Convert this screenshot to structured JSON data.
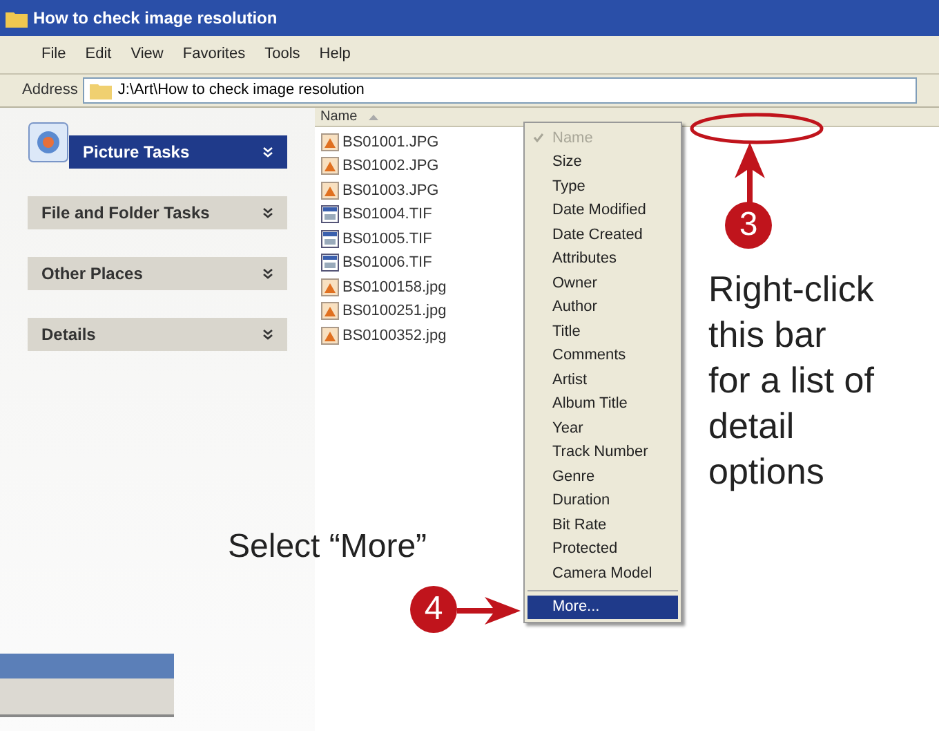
{
  "window": {
    "title": "How to check image resolution"
  },
  "menu_bar": [
    "File",
    "Edit",
    "View",
    "Favorites",
    "Tools",
    "Help"
  ],
  "address_bar": {
    "label": "Address",
    "value": "J:\\Art\\How to check image resolution"
  },
  "task_panes": [
    {
      "title": "Picture Tasks",
      "kind": "special"
    },
    {
      "title": "File and Folder Tasks",
      "kind": "normal"
    },
    {
      "title": "Other Places",
      "kind": "normal"
    },
    {
      "title": "Details",
      "kind": "normal"
    }
  ],
  "column_header": {
    "label": "Name"
  },
  "files": [
    {
      "name": "BS01001.JPG",
      "kind": "photo"
    },
    {
      "name": "BS01002.JPG",
      "kind": "photo"
    },
    {
      "name": "BS01003.JPG",
      "kind": "photo"
    },
    {
      "name": "BS01004.TIF",
      "kind": "tif"
    },
    {
      "name": "BS01005.TIF",
      "kind": "tif"
    },
    {
      "name": "BS01006.TIF",
      "kind": "tif"
    },
    {
      "name": "BS0100158.jpg",
      "kind": "photo"
    },
    {
      "name": "BS0100251.jpg",
      "kind": "photo"
    },
    {
      "name": "BS0100352.jpg",
      "kind": "photo"
    }
  ],
  "context_menu": [
    {
      "label": "Name",
      "checked": true,
      "disabled": true,
      "selected": false
    },
    {
      "label": "Size",
      "checked": false,
      "disabled": false,
      "selected": false
    },
    {
      "label": "Type",
      "checked": false,
      "disabled": false,
      "selected": false
    },
    {
      "label": "Date Modified",
      "checked": false,
      "disabled": false,
      "selected": false
    },
    {
      "label": "Date Created",
      "checked": false,
      "disabled": false,
      "selected": false
    },
    {
      "label": "Attributes",
      "checked": false,
      "disabled": false,
      "selected": false
    },
    {
      "label": "Owner",
      "checked": false,
      "disabled": false,
      "selected": false
    },
    {
      "label": "Author",
      "checked": false,
      "disabled": false,
      "selected": false
    },
    {
      "label": "Title",
      "checked": false,
      "disabled": false,
      "selected": false
    },
    {
      "label": "Comments",
      "checked": false,
      "disabled": false,
      "selected": false
    },
    {
      "label": "Artist",
      "checked": false,
      "disabled": false,
      "selected": false
    },
    {
      "label": "Album Title",
      "checked": false,
      "disabled": false,
      "selected": false
    },
    {
      "label": "Year",
      "checked": false,
      "disabled": false,
      "selected": false
    },
    {
      "label": "Track Number",
      "checked": false,
      "disabled": false,
      "selected": false
    },
    {
      "label": "Genre",
      "checked": false,
      "disabled": false,
      "selected": false
    },
    {
      "label": "Duration",
      "checked": false,
      "disabled": false,
      "selected": false
    },
    {
      "label": "Bit Rate",
      "checked": false,
      "disabled": false,
      "selected": false
    },
    {
      "label": "Protected",
      "checked": false,
      "disabled": false,
      "selected": false
    },
    {
      "label": "Camera Model",
      "checked": false,
      "disabled": false,
      "selected": false
    },
    {
      "label": "More...",
      "checked": false,
      "disabled": false,
      "selected": true,
      "kind": "separated"
    }
  ],
  "callouts": [
    {
      "number": "3",
      "text": "Right-click this bar for a list of detail options"
    },
    {
      "number": "4",
      "text": "Select “More”"
    }
  ]
}
